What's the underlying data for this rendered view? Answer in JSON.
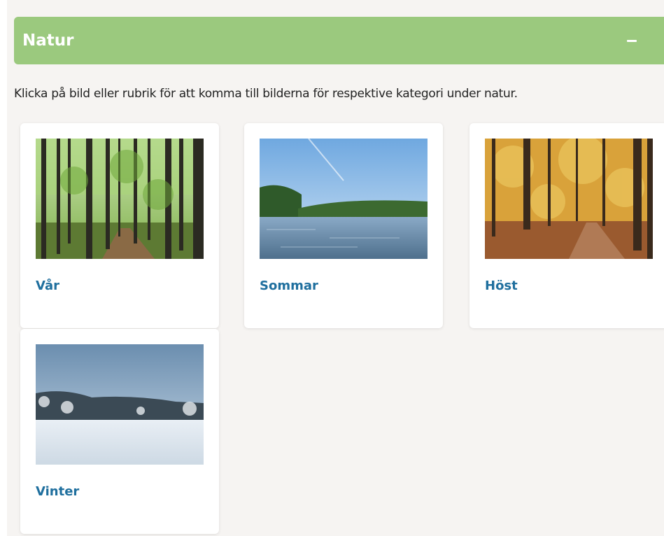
{
  "accordion": {
    "title": "Natur",
    "intro": "Klicka på bild eller rubrik för att komma till bilderna för respektive kategori under natur."
  },
  "categories": [
    {
      "label": "Vår",
      "image": "spring forest path"
    },
    {
      "label": "Sommar",
      "image": "summer lake with forest"
    },
    {
      "label": "Höst",
      "image": "autumn forest path"
    },
    {
      "label": "Vinter",
      "image": "snowy winter field"
    }
  ],
  "colors": {
    "header_bg": "#9bc97e",
    "link": "#1f6f9e",
    "page_bg": "#f6f4f2"
  }
}
